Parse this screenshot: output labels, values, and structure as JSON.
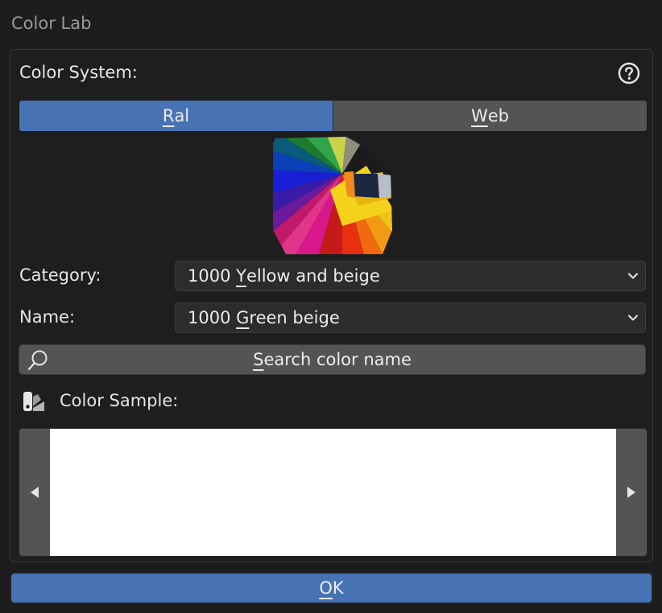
{
  "window": {
    "title": "Color Lab"
  },
  "color_system": {
    "label": "Color System:",
    "help_icon": "help-circle-icon",
    "options": [
      {
        "pre": "",
        "key": "R",
        "post": "al",
        "active": true
      },
      {
        "pre": "",
        "key": "W",
        "post": "eb",
        "active": false
      }
    ]
  },
  "category": {
    "label": "Category:",
    "value_pre": "1000 ",
    "value_key": "Y",
    "value_post": "ellow and beige"
  },
  "name": {
    "label": "Name:",
    "value_pre": "1000 ",
    "value_key": "G",
    "value_post": "reen beige"
  },
  "search": {
    "key": "S",
    "post": "earch color name",
    "icon": "search-icon"
  },
  "color_sample": {
    "label": "Color Sample:",
    "icon": "color-swatch-icon",
    "color": "#ffffff"
  },
  "ok": {
    "key": "O",
    "post": "K"
  },
  "colors": {
    "accent": "#4772b3",
    "button": "#545454",
    "field": "#2c2c2c",
    "background": "#1d1d1d"
  }
}
